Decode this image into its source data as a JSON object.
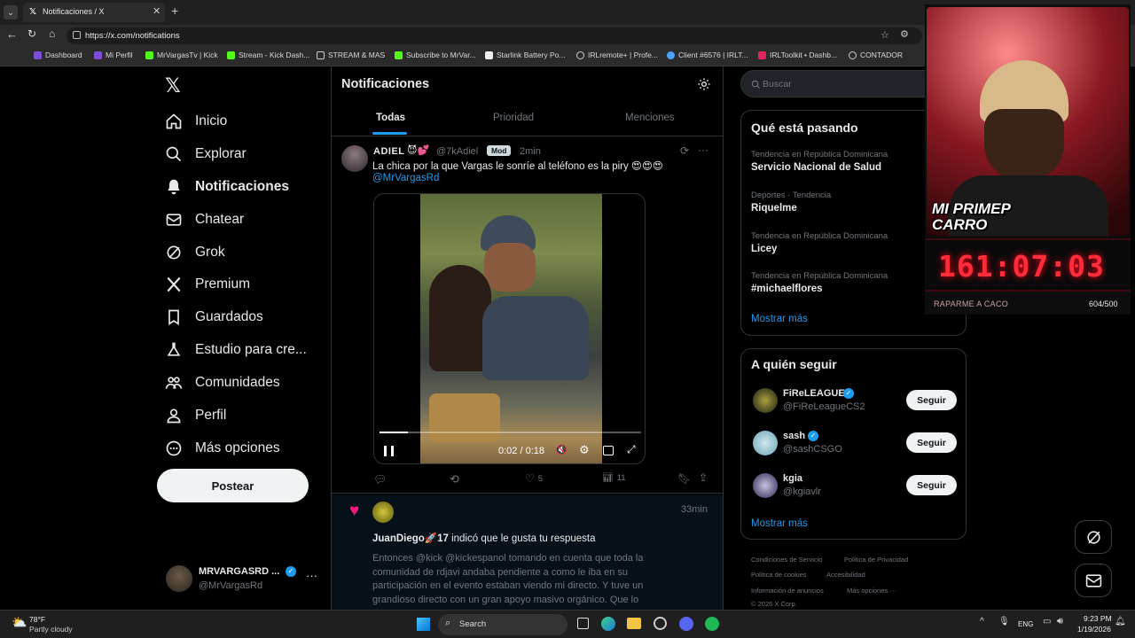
{
  "browser": {
    "tab_title": "Notificaciones / X",
    "url": "https://x.com/notifications",
    "bookmarks": [
      "Dashboard",
      "Mi Perfil",
      "MrVargasTv | Kick",
      "Stream - Kick Dash...",
      "STREAM & MAS",
      "Subscribe to MrVar...",
      "Starlink Battery Po...",
      "IRLremote+ | Profe...",
      "Client #6576 | IRLT...",
      "IRLToolkit • Dashb...",
      "CONTADOR"
    ]
  },
  "nav": {
    "items": [
      "Inicio",
      "Explorar",
      "Notificaciones",
      "Chatear",
      "Grok",
      "Premium",
      "Guardados",
      "Estudio para cre...",
      "Comunidades",
      "Perfil",
      "Más opciones"
    ],
    "post_label": "Postear",
    "account": {
      "name": "MRVARGASRD ...",
      "handle": "@MrVargasRd"
    }
  },
  "center": {
    "title": "Notificaciones",
    "tabs": [
      "Todas",
      "Prioridad",
      "Menciones"
    ],
    "post": {
      "name": "ADIEL",
      "handle": "@7kAdiel",
      "badge": "Mod",
      "time": "2min",
      "text": "La chica por la que Vargas le sonríe al teléfono es la piry 😍😍😍",
      "mention": "@MrVargasRd",
      "video_time": "0:02 / 0:18",
      "video_progress": 0.11,
      "likes": "5",
      "views": "11"
    },
    "like_notif": {
      "time": "33min",
      "user": "JuanDiego🚀17",
      "action": "indicó que le gusta tu respuesta",
      "text": "Entonces @kick @kickespanol tomando en cuenta que toda la comunidad de rdjavi andaba pendiente a como le iba en su participación en el evento estaban viendo mi directo. Y tuve un grandioso directo con un gran apoyo masivo orgánico. Que lo"
    }
  },
  "right": {
    "search_placeholder": "Buscar",
    "trending_title": "Qué está pasando",
    "trends": [
      {
        "sub": "Tendencia en República Dominicana",
        "name": "Servicio Nacional de Salud"
      },
      {
        "sub": "Deportes · Tendencia",
        "name": "Riquelme"
      },
      {
        "sub": "Tendencia en República Dominicana",
        "name": "Licey"
      },
      {
        "sub": "Tendencia en República Dominicana",
        "name": "#michaelflores"
      }
    ],
    "show_more": "Mostrar más",
    "follow_title": "A quién seguir",
    "follow": [
      {
        "name": "FiReLEAGUE",
        "handle": "@FiReLeagueCS2",
        "verified": true
      },
      {
        "name": "sash",
        "handle": "@sashCSGO",
        "verified": true
      },
      {
        "name": "kgia",
        "handle": "@kgiavlr",
        "verified": false
      }
    ],
    "follow_btn": "Seguir",
    "footer": [
      "Condiciones de Servicio",
      "Política de Privacidad",
      "Política de cookies",
      "Accesibilidad",
      "Información de anuncios",
      "Más opciones ···",
      "© 2026 X Corp."
    ]
  },
  "overlay": {
    "banner": "MI PRIMEP CARRO",
    "timer": "161:07:03",
    "goal_label": "RAPARME A CACO",
    "goal_count": "604/500"
  },
  "taskbar": {
    "weather_temp": "78°F",
    "weather_desc": "Partly cloudy",
    "search": "Search",
    "lang": "ENG",
    "time": "9:23 PM",
    "date": "1/19/2026"
  },
  "colors": {
    "accent": "#1d9bf0",
    "like": "#f91880",
    "timer": "#ff2d3a"
  }
}
